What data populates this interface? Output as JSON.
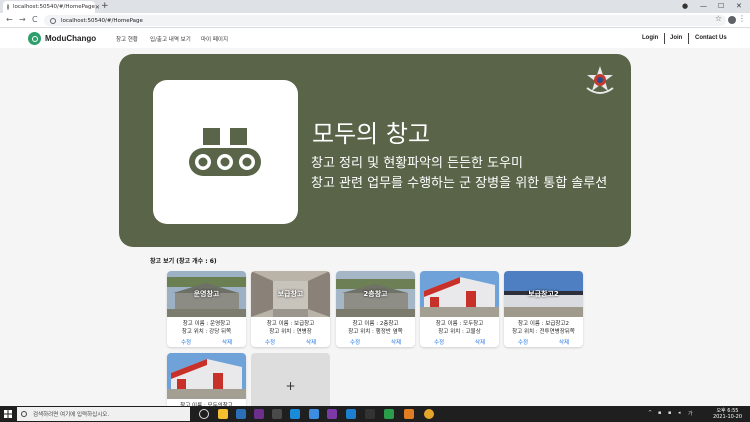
{
  "browser": {
    "tab_title": "localhost:50540/#/HomePage",
    "url": "localhost:50540/#/HomePage",
    "new_tab": "+",
    "tab_close": "✕",
    "back": "←",
    "forward": "→",
    "reload": "C",
    "bookmark": "☆",
    "menu": "⋮",
    "minimize": "—",
    "maximize": "☐",
    "close": "✕"
  },
  "nav": {
    "brand": "ModuChango",
    "links": [
      "창고 현황",
      "입/출고 내역 보기",
      "마이 페이지"
    ],
    "login": "Login",
    "join": "Join",
    "contact": "Contact Us"
  },
  "hero": {
    "title": "모두의 창고",
    "subtitle_1": "창고 정리 및 현황파악의 든든한 도우미",
    "subtitle_2": "창고 관련 업무를 수행하는 군 장병을 위한 통합 솔루션",
    "bg_color": "#596448"
  },
  "warehouses": {
    "heading": "창고 보기 (창고 개수 : 6)",
    "edit_label": "수정",
    "delete_label": "삭제",
    "add_label": "+",
    "items": [
      {
        "photo_label": "운영창고",
        "name": "창고 이름 : 운영창고",
        "location": "창고 위치 : 강당 뒤쪽"
      },
      {
        "photo_label": "보급창고",
        "name": "창고 이름 : 보급창고",
        "location": "창고 위치 : 연병장"
      },
      {
        "photo_label": "2층창고",
        "name": "창고 이름 : 2층창고",
        "location": "창고 위치 : 행정반 옆쪽"
      },
      {
        "photo_label": "",
        "name": "창고 이름 : 모두창고",
        "location": "창고 위치 : 고물상"
      },
      {
        "photo_label": "보급창고2",
        "name": "창고 이름 : 보급창고2",
        "location": "창고 위치 : 전투연병장뒤쪽"
      },
      {
        "photo_label": "",
        "name": "창고 이름 : 모두의창고",
        "location": ""
      }
    ]
  },
  "taskbar": {
    "search_placeholder": "검색하려면 여기에 입력하십시오.",
    "time": "오후 6:55",
    "date": "2021-10-20"
  }
}
